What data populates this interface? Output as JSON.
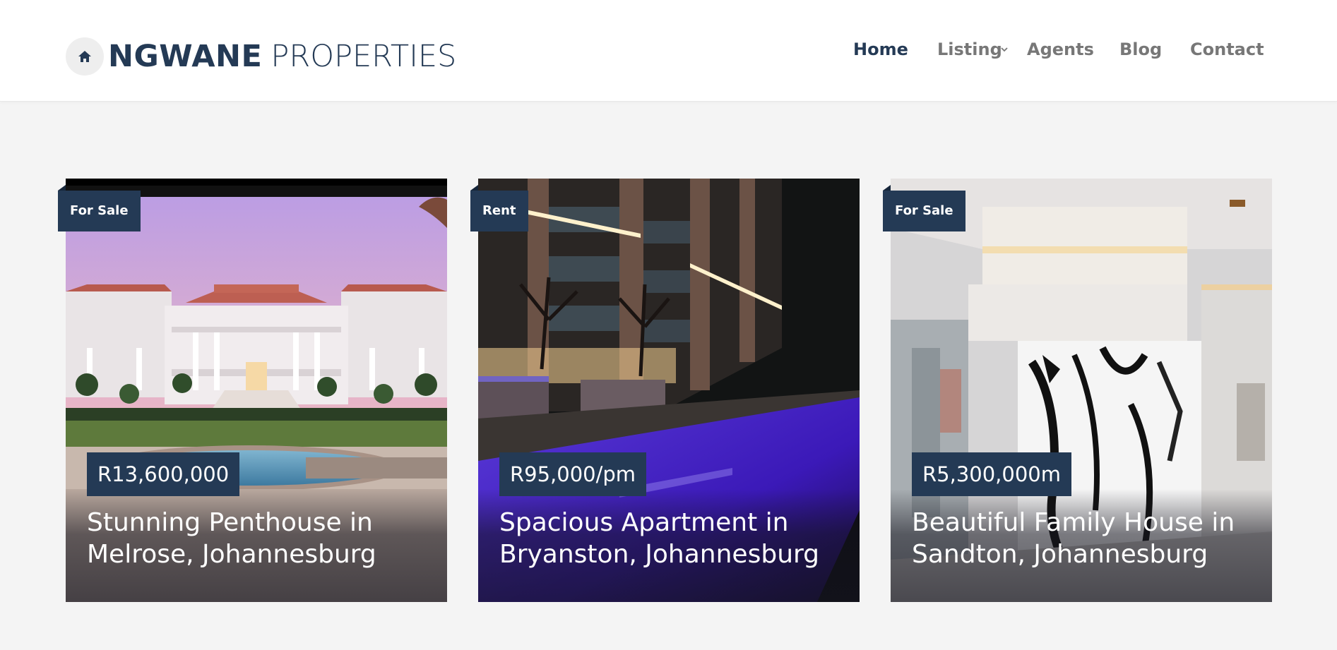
{
  "brand": {
    "name_bold": "NGWANE",
    "name_light": "PROPERTIES",
    "icon": "home-icon"
  },
  "nav": {
    "items": [
      {
        "label": "Home",
        "active": true
      },
      {
        "label": "Listing",
        "active": false,
        "has_dropdown": true
      },
      {
        "label": "Agents",
        "active": false
      },
      {
        "label": "Blog",
        "active": false
      },
      {
        "label": "Contact",
        "active": false
      }
    ]
  },
  "listings": [
    {
      "status": "For Sale",
      "price": "R13,600,000",
      "title": "Stunning Penthouse in Melrose, Johannesburg"
    },
    {
      "status": "Rent",
      "price": "R95,000/pm",
      "title": "Spacious Apartment in Bryanston, Johannesburg"
    },
    {
      "status": "For Sale",
      "price": "R5,300,000m",
      "title": "Beautiful Family House in Sandton, Johannesburg"
    }
  ],
  "colors": {
    "brand_navy": "#243a55",
    "nav_inactive": "#777777",
    "page_background": "#f4f4f4"
  }
}
